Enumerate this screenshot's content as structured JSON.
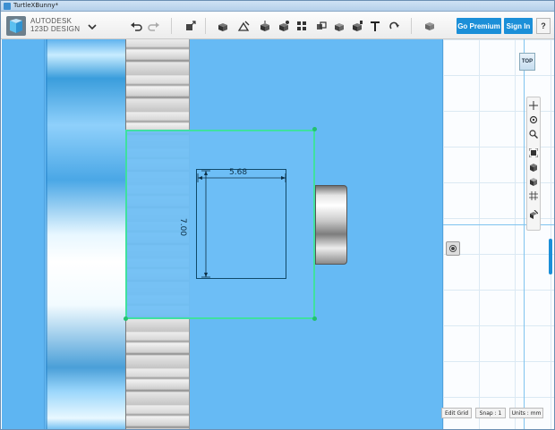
{
  "window": {
    "title": "TurtleXBunny*"
  },
  "brand": {
    "line1": "AUTODESK",
    "line2": "123D DESIGN"
  },
  "toolbar": {
    "icons": [
      "undo-icon",
      "redo-icon",
      "transform-icon",
      "sketch-icon",
      "construct-icon",
      "modify-icon",
      "pattern-icon",
      "group-icon",
      "combine-icon",
      "measure-icon",
      "text-icon",
      "snap-icon",
      "material-icon"
    ],
    "go_premium_label": "Go Premium",
    "sign_in_label": "Sign In",
    "help_label": "?"
  },
  "viewport": {
    "dim_width": "5.68",
    "dim_height": "7.00"
  },
  "view": {
    "cube_label": "TOP"
  },
  "status": {
    "edit_grid_label": "Edit Grid",
    "snap_label": "Snap : 1",
    "units_label": "Units : mm"
  },
  "colors": {
    "accent": "#1b8fd8",
    "viewport": "#66baf4",
    "selection": "#3fe0a0"
  }
}
